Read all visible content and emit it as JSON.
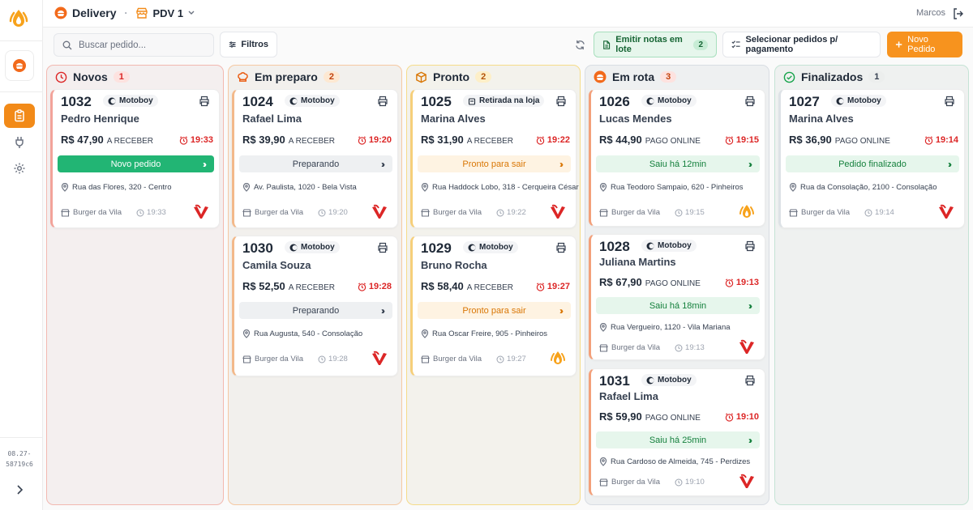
{
  "app": {
    "title": "Delivery",
    "pdv": "PDV 1",
    "user": "Marcos",
    "version_line1": "08.27-",
    "version_line2": "58719c6"
  },
  "toolbar": {
    "search_placeholder": "Buscar pedido...",
    "filters": "Filtros",
    "notes_label": "Emitir notas em lote",
    "notes_count": "2",
    "select_label": "Selecionar pedidos p/ pagamento",
    "new_order": "Novo Pedido"
  },
  "columns": [
    {
      "title": "Novos",
      "count": "1",
      "color": "#f2b8b0",
      "bg": "#f4efef",
      "count_bg": "#fde2df",
      "count_color": "#dc2626",
      "icon": "clock-icon",
      "cards": [
        {
          "id": "1032",
          "tag": "Motoboy",
          "name": "Pedro Henrique",
          "price": "R$ 47,90",
          "pay": "A RECEBER",
          "time": "19:33",
          "status": "Novo pedido",
          "status_style": "green-solid",
          "address": "Rua das Flores, 320 - Centro",
          "store": "Burger da Vila",
          "store_time": "19:33",
          "logo": "v"
        }
      ]
    },
    {
      "title": "Em preparo",
      "count": "2",
      "color": "#f5c9a3",
      "bg": "#f2f0ed",
      "count_bg": "#fde8d2",
      "count_color": "#c2410c",
      "icon": "chef-hat-icon",
      "cards": [
        {
          "id": "1024",
          "tag": "Motoboy",
          "name": "Rafael Lima",
          "price": "R$ 39,90",
          "pay": "A RECEBER",
          "time": "19:20",
          "status": "Preparando",
          "status_style": "gray",
          "address": "Av. Paulista, 1020 - Bela Vista",
          "store": "Burger da Vila",
          "store_time": "19:20",
          "logo": "v"
        },
        {
          "id": "1030",
          "tag": "Motoboy",
          "name": "Camila Souza",
          "price": "R$ 52,50",
          "pay": "A RECEBER",
          "time": "19:28",
          "status": "Preparando",
          "status_style": "gray",
          "address": "Rua Augusta, 540 - Consolação",
          "store": "Burger da Vila",
          "store_time": "19:28",
          "logo": "v"
        }
      ]
    },
    {
      "title": "Pronto",
      "count": "2",
      "color": "#f5dc8a",
      "bg": "#f3f2ec",
      "count_bg": "#fdefc8",
      "count_color": "#b45309",
      "icon": "package-icon",
      "cards": [
        {
          "id": "1025",
          "tag": "Retirada na loja",
          "name": "Marina Alves",
          "price": "R$ 31,90",
          "pay": "A RECEBER",
          "time": "19:22",
          "status": "Pronto para sair",
          "status_style": "orange",
          "address": "Rua Haddock Lobo, 318 - Cerqueira César",
          "store": "Burger da Vila",
          "store_time": "19:22",
          "logo": "v"
        },
        {
          "id": "1029",
          "tag": "Motoboy",
          "name": "Bruno Rocha",
          "price": "R$ 58,40",
          "pay": "A RECEBER",
          "time": "19:27",
          "status": "Pronto para sair",
          "status_style": "orange",
          "address": "Rua Oscar Freire, 905 - Pinheiros",
          "store": "Burger da Vila",
          "store_time": "19:27",
          "logo": "flame"
        }
      ]
    },
    {
      "title": "Em rota",
      "count": "3",
      "color": "#d8dde3",
      "bg": "#eef0f1",
      "count_bg": "#fde2df",
      "count_color": "#c2410c",
      "icon": "scooter-icon",
      "cards": [
        {
          "id": "1026",
          "tag": "Motoboy",
          "name": "Lucas Mendes",
          "price": "R$ 44,90",
          "pay": "PAGO ONLINE",
          "time": "19:15",
          "status": "Saiu há 12min",
          "status_style": "green-soft",
          "address": "Rua Teodoro Sampaio, 620 - Pinheiros",
          "store": "Burger da Vila",
          "store_time": "19:15",
          "logo": "flame"
        },
        {
          "id": "1028",
          "tag": "Motoboy",
          "name": "Juliana Martins",
          "price": "R$ 67,90",
          "pay": "PAGO ONLINE",
          "time": "19:13",
          "status": "Saiu há 18min",
          "status_style": "green-soft",
          "address": "Rua Vergueiro, 1120 - Vila Mariana",
          "store": "Burger da Vila",
          "store_time": "19:13",
          "logo": "v"
        },
        {
          "id": "1031",
          "tag": "Motoboy",
          "name": "Rafael Lima",
          "price": "R$ 59,90",
          "pay": "PAGO ONLINE",
          "time": "19:10",
          "status": "Saiu há 25min",
          "status_style": "green-soft",
          "address": "Rua Cardoso de Almeida, 745 - Perdizes",
          "store": "Burger da Vila",
          "store_time": "19:10",
          "logo": "v"
        }
      ]
    },
    {
      "title": "Finalizados",
      "count": "1",
      "color": "#c5e3d5",
      "bg": "#eff1f0",
      "count_bg": "#eceeed",
      "count_color": "#374151",
      "icon": "check-circle-icon",
      "cards": [
        {
          "id": "1027",
          "tag": "Motoboy",
          "name": "Marina Alves",
          "price": "R$ 36,90",
          "pay": "PAGO ONLINE",
          "time": "19:14",
          "status": "Pedido finalizado",
          "status_style": "green-soft",
          "address": "Rua da Consolação, 2100 - Consolação",
          "store": "Burger da Vila",
          "store_time": "19:14",
          "logo": "v"
        }
      ]
    }
  ]
}
